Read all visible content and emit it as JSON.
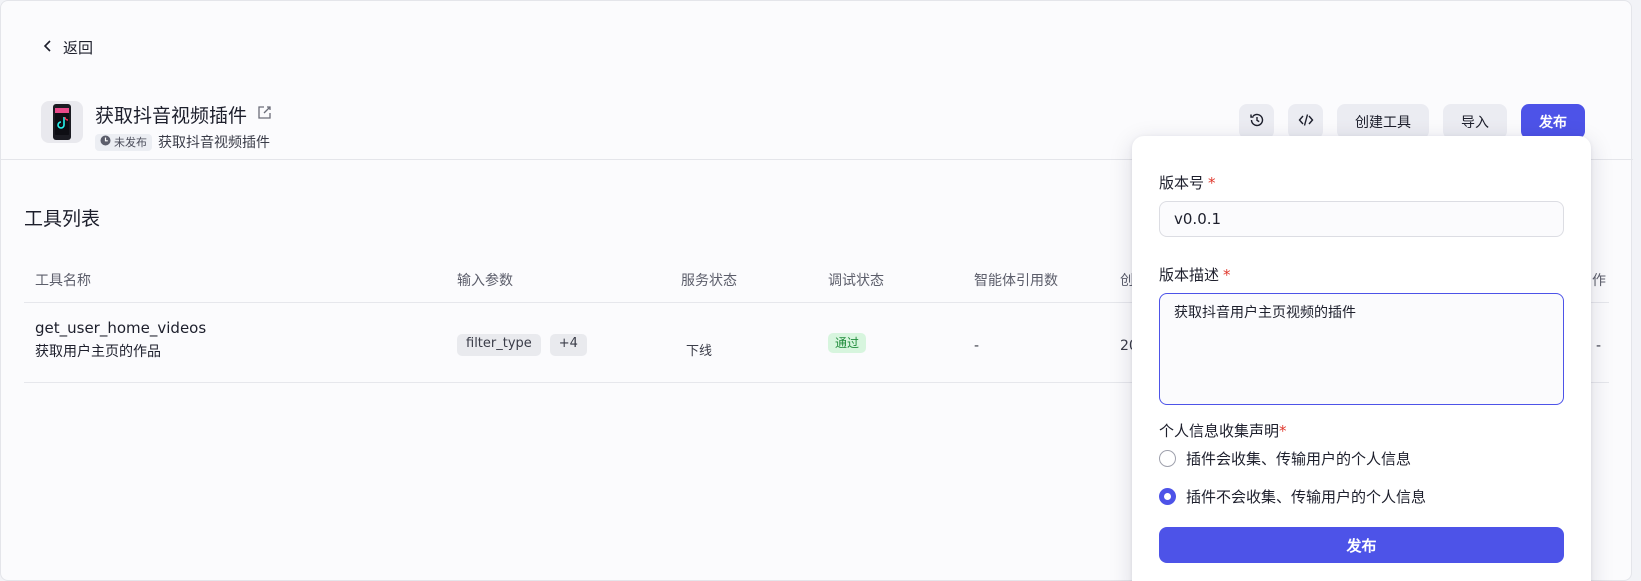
{
  "nav": {
    "back_label": "返回"
  },
  "plugin": {
    "title": "获取抖音视频插件",
    "status": "未发布",
    "description": "获取抖音视频插件"
  },
  "toolbar": {
    "create_tool_label": "创建工具",
    "import_label": "导入",
    "publish_label": "发布",
    "icons": [
      "history-icon",
      "code-icon"
    ]
  },
  "tools_section": {
    "title": "工具列表",
    "columns": [
      "工具名称",
      "输入参数",
      "服务状态",
      "调试状态",
      "智能体引用数",
      "创",
      "作"
    ],
    "rows": [
      {
        "name": "get_user_home_videos",
        "desc": "获取用户主页的作品",
        "params": [
          "filter_type",
          "+4"
        ],
        "service_status": "下线",
        "debug_status": "通过",
        "agent_refs": "-",
        "created": "20",
        "action": "-"
      }
    ]
  },
  "publish_form": {
    "version_label": "版本号",
    "version_value": "v0.0.1",
    "desc_label": "版本描述",
    "desc_value": "获取抖音用户主页视频的插件",
    "privacy_label": "个人信息收集声明",
    "option_collects": "插件会收集、传输用户的个人信息",
    "option_no_collect": "插件不会收集、传输用户的个人信息",
    "selected_option": "option_no_collect",
    "submit_label": "发布",
    "required_mark": "*"
  },
  "colors": {
    "accent": "#4d53e8",
    "required": "#e0392e",
    "pass_bg": "#d7f5de",
    "pass_fg": "#1f8c3b"
  }
}
